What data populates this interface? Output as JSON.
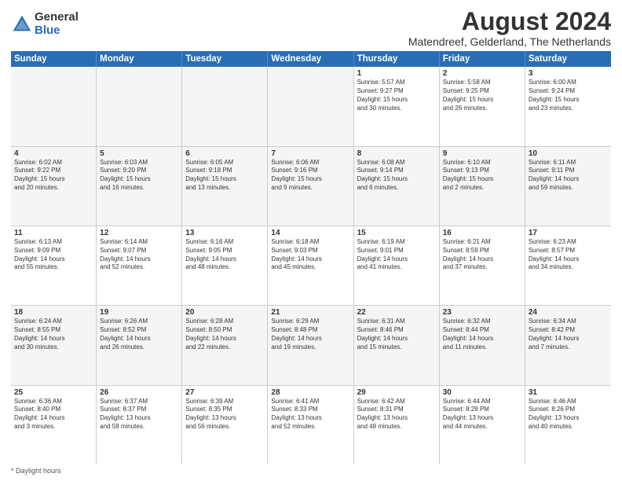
{
  "logo": {
    "general": "General",
    "blue": "Blue"
  },
  "title": "August 2024",
  "subtitle": "Matendreef, Gelderland, The Netherlands",
  "days": [
    "Sunday",
    "Monday",
    "Tuesday",
    "Wednesday",
    "Thursday",
    "Friday",
    "Saturday"
  ],
  "weeks": [
    [
      {
        "day": "",
        "content": ""
      },
      {
        "day": "",
        "content": ""
      },
      {
        "day": "",
        "content": ""
      },
      {
        "day": "",
        "content": ""
      },
      {
        "day": "1",
        "content": "Sunrise: 5:57 AM\nSunset: 9:27 PM\nDaylight: 15 hours\nand 30 minutes."
      },
      {
        "day": "2",
        "content": "Sunrise: 5:58 AM\nSunset: 9:25 PM\nDaylight: 15 hours\nand 26 minutes."
      },
      {
        "day": "3",
        "content": "Sunrise: 6:00 AM\nSunset: 9:24 PM\nDaylight: 15 hours\nand 23 minutes."
      }
    ],
    [
      {
        "day": "4",
        "content": "Sunrise: 6:02 AM\nSunset: 9:22 PM\nDaylight: 15 hours\nand 20 minutes."
      },
      {
        "day": "5",
        "content": "Sunrise: 6:03 AM\nSunset: 9:20 PM\nDaylight: 15 hours\nand 16 minutes."
      },
      {
        "day": "6",
        "content": "Sunrise: 6:05 AM\nSunset: 9:18 PM\nDaylight: 15 hours\nand 13 minutes."
      },
      {
        "day": "7",
        "content": "Sunrise: 6:06 AM\nSunset: 9:16 PM\nDaylight: 15 hours\nand 9 minutes."
      },
      {
        "day": "8",
        "content": "Sunrise: 6:08 AM\nSunset: 9:14 PM\nDaylight: 15 hours\nand 6 minutes."
      },
      {
        "day": "9",
        "content": "Sunrise: 6:10 AM\nSunset: 9:13 PM\nDaylight: 15 hours\nand 2 minutes."
      },
      {
        "day": "10",
        "content": "Sunrise: 6:11 AM\nSunset: 9:11 PM\nDaylight: 14 hours\nand 59 minutes."
      }
    ],
    [
      {
        "day": "11",
        "content": "Sunrise: 6:13 AM\nSunset: 9:09 PM\nDaylight: 14 hours\nand 55 minutes."
      },
      {
        "day": "12",
        "content": "Sunrise: 6:14 AM\nSunset: 9:07 PM\nDaylight: 14 hours\nand 52 minutes."
      },
      {
        "day": "13",
        "content": "Sunrise: 6:16 AM\nSunset: 9:05 PM\nDaylight: 14 hours\nand 48 minutes."
      },
      {
        "day": "14",
        "content": "Sunrise: 6:18 AM\nSunset: 9:03 PM\nDaylight: 14 hours\nand 45 minutes."
      },
      {
        "day": "15",
        "content": "Sunrise: 6:19 AM\nSunset: 9:01 PM\nDaylight: 14 hours\nand 41 minutes."
      },
      {
        "day": "16",
        "content": "Sunrise: 6:21 AM\nSunset: 8:59 PM\nDaylight: 14 hours\nand 37 minutes."
      },
      {
        "day": "17",
        "content": "Sunrise: 6:23 AM\nSunset: 8:57 PM\nDaylight: 14 hours\nand 34 minutes."
      }
    ],
    [
      {
        "day": "18",
        "content": "Sunrise: 6:24 AM\nSunset: 8:55 PM\nDaylight: 14 hours\nand 30 minutes."
      },
      {
        "day": "19",
        "content": "Sunrise: 6:26 AM\nSunset: 8:52 PM\nDaylight: 14 hours\nand 26 minutes."
      },
      {
        "day": "20",
        "content": "Sunrise: 6:28 AM\nSunset: 8:50 PM\nDaylight: 14 hours\nand 22 minutes."
      },
      {
        "day": "21",
        "content": "Sunrise: 6:29 AM\nSunset: 8:48 PM\nDaylight: 14 hours\nand 19 minutes."
      },
      {
        "day": "22",
        "content": "Sunrise: 6:31 AM\nSunset: 8:46 PM\nDaylight: 14 hours\nand 15 minutes."
      },
      {
        "day": "23",
        "content": "Sunrise: 6:32 AM\nSunset: 8:44 PM\nDaylight: 14 hours\nand 11 minutes."
      },
      {
        "day": "24",
        "content": "Sunrise: 6:34 AM\nSunset: 8:42 PM\nDaylight: 14 hours\nand 7 minutes."
      }
    ],
    [
      {
        "day": "25",
        "content": "Sunrise: 6:36 AM\nSunset: 8:40 PM\nDaylight: 14 hours\nand 3 minutes."
      },
      {
        "day": "26",
        "content": "Sunrise: 6:37 AM\nSunset: 8:37 PM\nDaylight: 13 hours\nand 59 minutes."
      },
      {
        "day": "27",
        "content": "Sunrise: 6:39 AM\nSunset: 8:35 PM\nDaylight: 13 hours\nand 56 minutes."
      },
      {
        "day": "28",
        "content": "Sunrise: 6:41 AM\nSunset: 8:33 PM\nDaylight: 13 hours\nand 52 minutes."
      },
      {
        "day": "29",
        "content": "Sunrise: 6:42 AM\nSunset: 8:31 PM\nDaylight: 13 hours\nand 48 minutes."
      },
      {
        "day": "30",
        "content": "Sunrise: 6:44 AM\nSunset: 8:28 PM\nDaylight: 13 hours\nand 44 minutes."
      },
      {
        "day": "31",
        "content": "Sunrise: 6:46 AM\nSunset: 8:26 PM\nDaylight: 13 hours\nand 40 minutes."
      }
    ]
  ],
  "footer": "* Daylight hours"
}
